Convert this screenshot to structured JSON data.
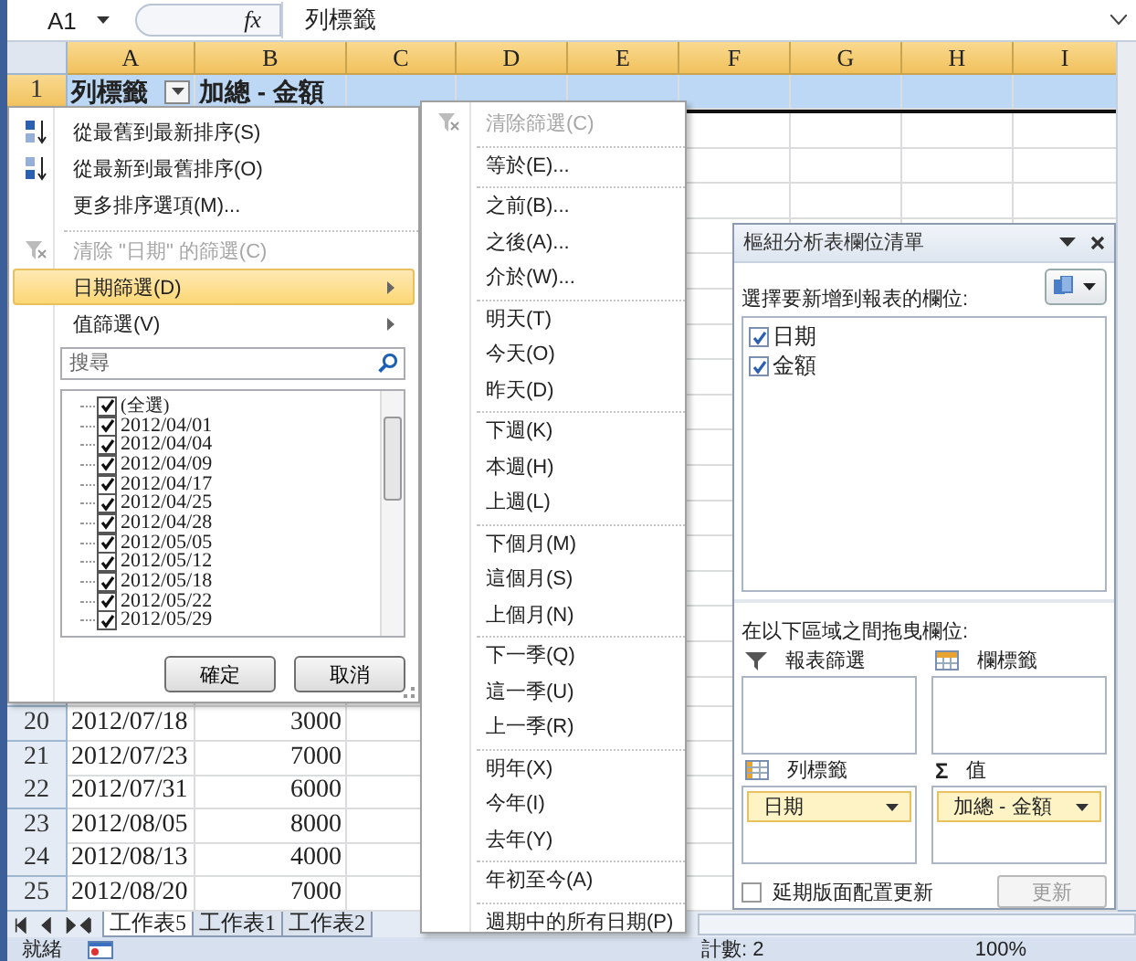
{
  "name_box": {
    "value": "A1"
  },
  "formula_bar": {
    "function_button": "fx",
    "value": "列標籤"
  },
  "columns": [
    {
      "label": "A",
      "selected": true
    },
    {
      "label": "B",
      "selected": true
    },
    {
      "label": "C",
      "selected": true
    },
    {
      "label": "D",
      "selected": true
    },
    {
      "label": "E",
      "selected": true
    },
    {
      "label": "F",
      "selected": true
    },
    {
      "label": "G",
      "selected": true
    },
    {
      "label": "H",
      "selected": true
    },
    {
      "label": "I",
      "selected": true
    }
  ],
  "header_row": {
    "number": "1",
    "selected": true,
    "row_label": "列標籤",
    "value_label": "加總 - 金額"
  },
  "data_rows": [
    {
      "number": "20",
      "date": "2012/07/18",
      "amount": "3000"
    },
    {
      "number": "21",
      "date": "2012/07/23",
      "amount": "7000"
    },
    {
      "number": "22",
      "date": "2012/07/31",
      "amount": "6000"
    },
    {
      "number": "23",
      "date": "2012/08/05",
      "amount": "8000"
    },
    {
      "number": "24",
      "date": "2012/08/13",
      "amount": "4000"
    },
    {
      "number": "25",
      "date": "2012/08/20",
      "amount": "7000"
    }
  ],
  "sheet_tabs": [
    {
      "label": "工作表5",
      "selected": true
    },
    {
      "label": "工作表1",
      "selected": false
    },
    {
      "label": "工作表2",
      "selected": false
    }
  ],
  "status_bar": {
    "ready": "就緒",
    "count": "計數: 2",
    "zoom": "100%"
  },
  "filter_menu": {
    "items": [
      {
        "kind": "sort-asc",
        "label": "從最舊到最新排序(S)",
        "selected": false,
        "disabled": false
      },
      {
        "kind": "sort-desc",
        "label": "從最新到最舊排序(O)",
        "selected": false,
        "disabled": false
      },
      {
        "kind": "plain",
        "label": "更多排序選項(M)...",
        "selected": false,
        "disabled": false
      },
      {
        "kind": "divider"
      },
      {
        "kind": "clear",
        "label": "清除 \"日期\" 的篩選(C)",
        "selected": false,
        "disabled": true
      },
      {
        "kind": "submenu",
        "label": "日期篩選(D)",
        "selected": true,
        "disabled": false
      },
      {
        "kind": "submenu",
        "label": "值篩選(V)",
        "selected": false,
        "disabled": false
      }
    ],
    "search": {
      "placeholder": "搜尋"
    },
    "values": [
      {
        "label": "(全選)",
        "checked": true
      },
      {
        "label": "2012/04/01",
        "checked": true
      },
      {
        "label": "2012/04/04",
        "checked": true
      },
      {
        "label": "2012/04/09",
        "checked": true
      },
      {
        "label": "2012/04/17",
        "checked": true
      },
      {
        "label": "2012/04/25",
        "checked": true
      },
      {
        "label": "2012/04/28",
        "checked": true
      },
      {
        "label": "2012/05/05",
        "checked": true
      },
      {
        "label": "2012/05/12",
        "checked": true
      },
      {
        "label": "2012/05/18",
        "checked": true
      },
      {
        "label": "2012/05/22",
        "checked": true
      },
      {
        "label": "2012/05/29",
        "checked": true
      }
    ],
    "buttons": [
      "確定",
      "取消"
    ]
  },
  "date_filter_menu": {
    "items": [
      {
        "kind": "clear",
        "label": "清除篩選(C)",
        "disabled": true
      },
      {
        "kind": "divider"
      },
      {
        "kind": "item",
        "label": "等於(E)...",
        "disabled": false
      },
      {
        "kind": "divider"
      },
      {
        "kind": "item",
        "label": "之前(B)...",
        "disabled": false
      },
      {
        "kind": "item",
        "label": "之後(A)...",
        "disabled": false
      },
      {
        "kind": "item",
        "label": "介於(W)...",
        "disabled": false
      },
      {
        "kind": "divider"
      },
      {
        "kind": "item",
        "label": "明天(T)",
        "disabled": false
      },
      {
        "kind": "item",
        "label": "今天(O)",
        "disabled": false
      },
      {
        "kind": "item",
        "label": "昨天(D)",
        "disabled": false
      },
      {
        "kind": "divider"
      },
      {
        "kind": "item",
        "label": "下週(K)",
        "disabled": false
      },
      {
        "kind": "item",
        "label": "本週(H)",
        "disabled": false
      },
      {
        "kind": "item",
        "label": "上週(L)",
        "disabled": false
      },
      {
        "kind": "divider"
      },
      {
        "kind": "item",
        "label": "下個月(M)",
        "disabled": false
      },
      {
        "kind": "item",
        "label": "這個月(S)",
        "disabled": false
      },
      {
        "kind": "item",
        "label": "上個月(N)",
        "disabled": false
      },
      {
        "kind": "divider"
      },
      {
        "kind": "item",
        "label": "下一季(Q)",
        "disabled": false
      },
      {
        "kind": "item",
        "label": "這一季(U)",
        "disabled": false
      },
      {
        "kind": "item",
        "label": "上一季(R)",
        "disabled": false
      },
      {
        "kind": "divider"
      },
      {
        "kind": "item",
        "label": "明年(X)",
        "disabled": false
      },
      {
        "kind": "item",
        "label": "今年(I)",
        "disabled": false
      },
      {
        "kind": "item",
        "label": "去年(Y)",
        "disabled": false
      },
      {
        "kind": "divider"
      },
      {
        "kind": "item",
        "label": "年初至今(A)",
        "disabled": false
      },
      {
        "kind": "divider"
      },
      {
        "kind": "submenu",
        "label": "週期中的所有日期(P)",
        "disabled": false
      }
    ]
  },
  "pivot_panel": {
    "title": "樞紐分析表欄位清單",
    "field_prompt": "選擇要新增到報表的欄位:",
    "fields": [
      {
        "label": "日期",
        "checked": true
      },
      {
        "label": "金額",
        "checked": true
      }
    ],
    "areas_prompt": "在以下區域之間拖曳欄位:",
    "areas": [
      {
        "kind": "filter",
        "label": "報表篩選"
      },
      {
        "kind": "columns",
        "label": "欄標籤"
      },
      {
        "kind": "rows",
        "label": "列標籤",
        "chips": [
          "日期"
        ]
      },
      {
        "kind": "values",
        "symbol": "Σ",
        "label": "值",
        "chips": [
          "加總 - 金額"
        ]
      }
    ],
    "defer_update": {
      "label": "延期版面配置更新",
      "checked": false
    },
    "update_button": {
      "label": "更新",
      "disabled": true
    }
  }
}
